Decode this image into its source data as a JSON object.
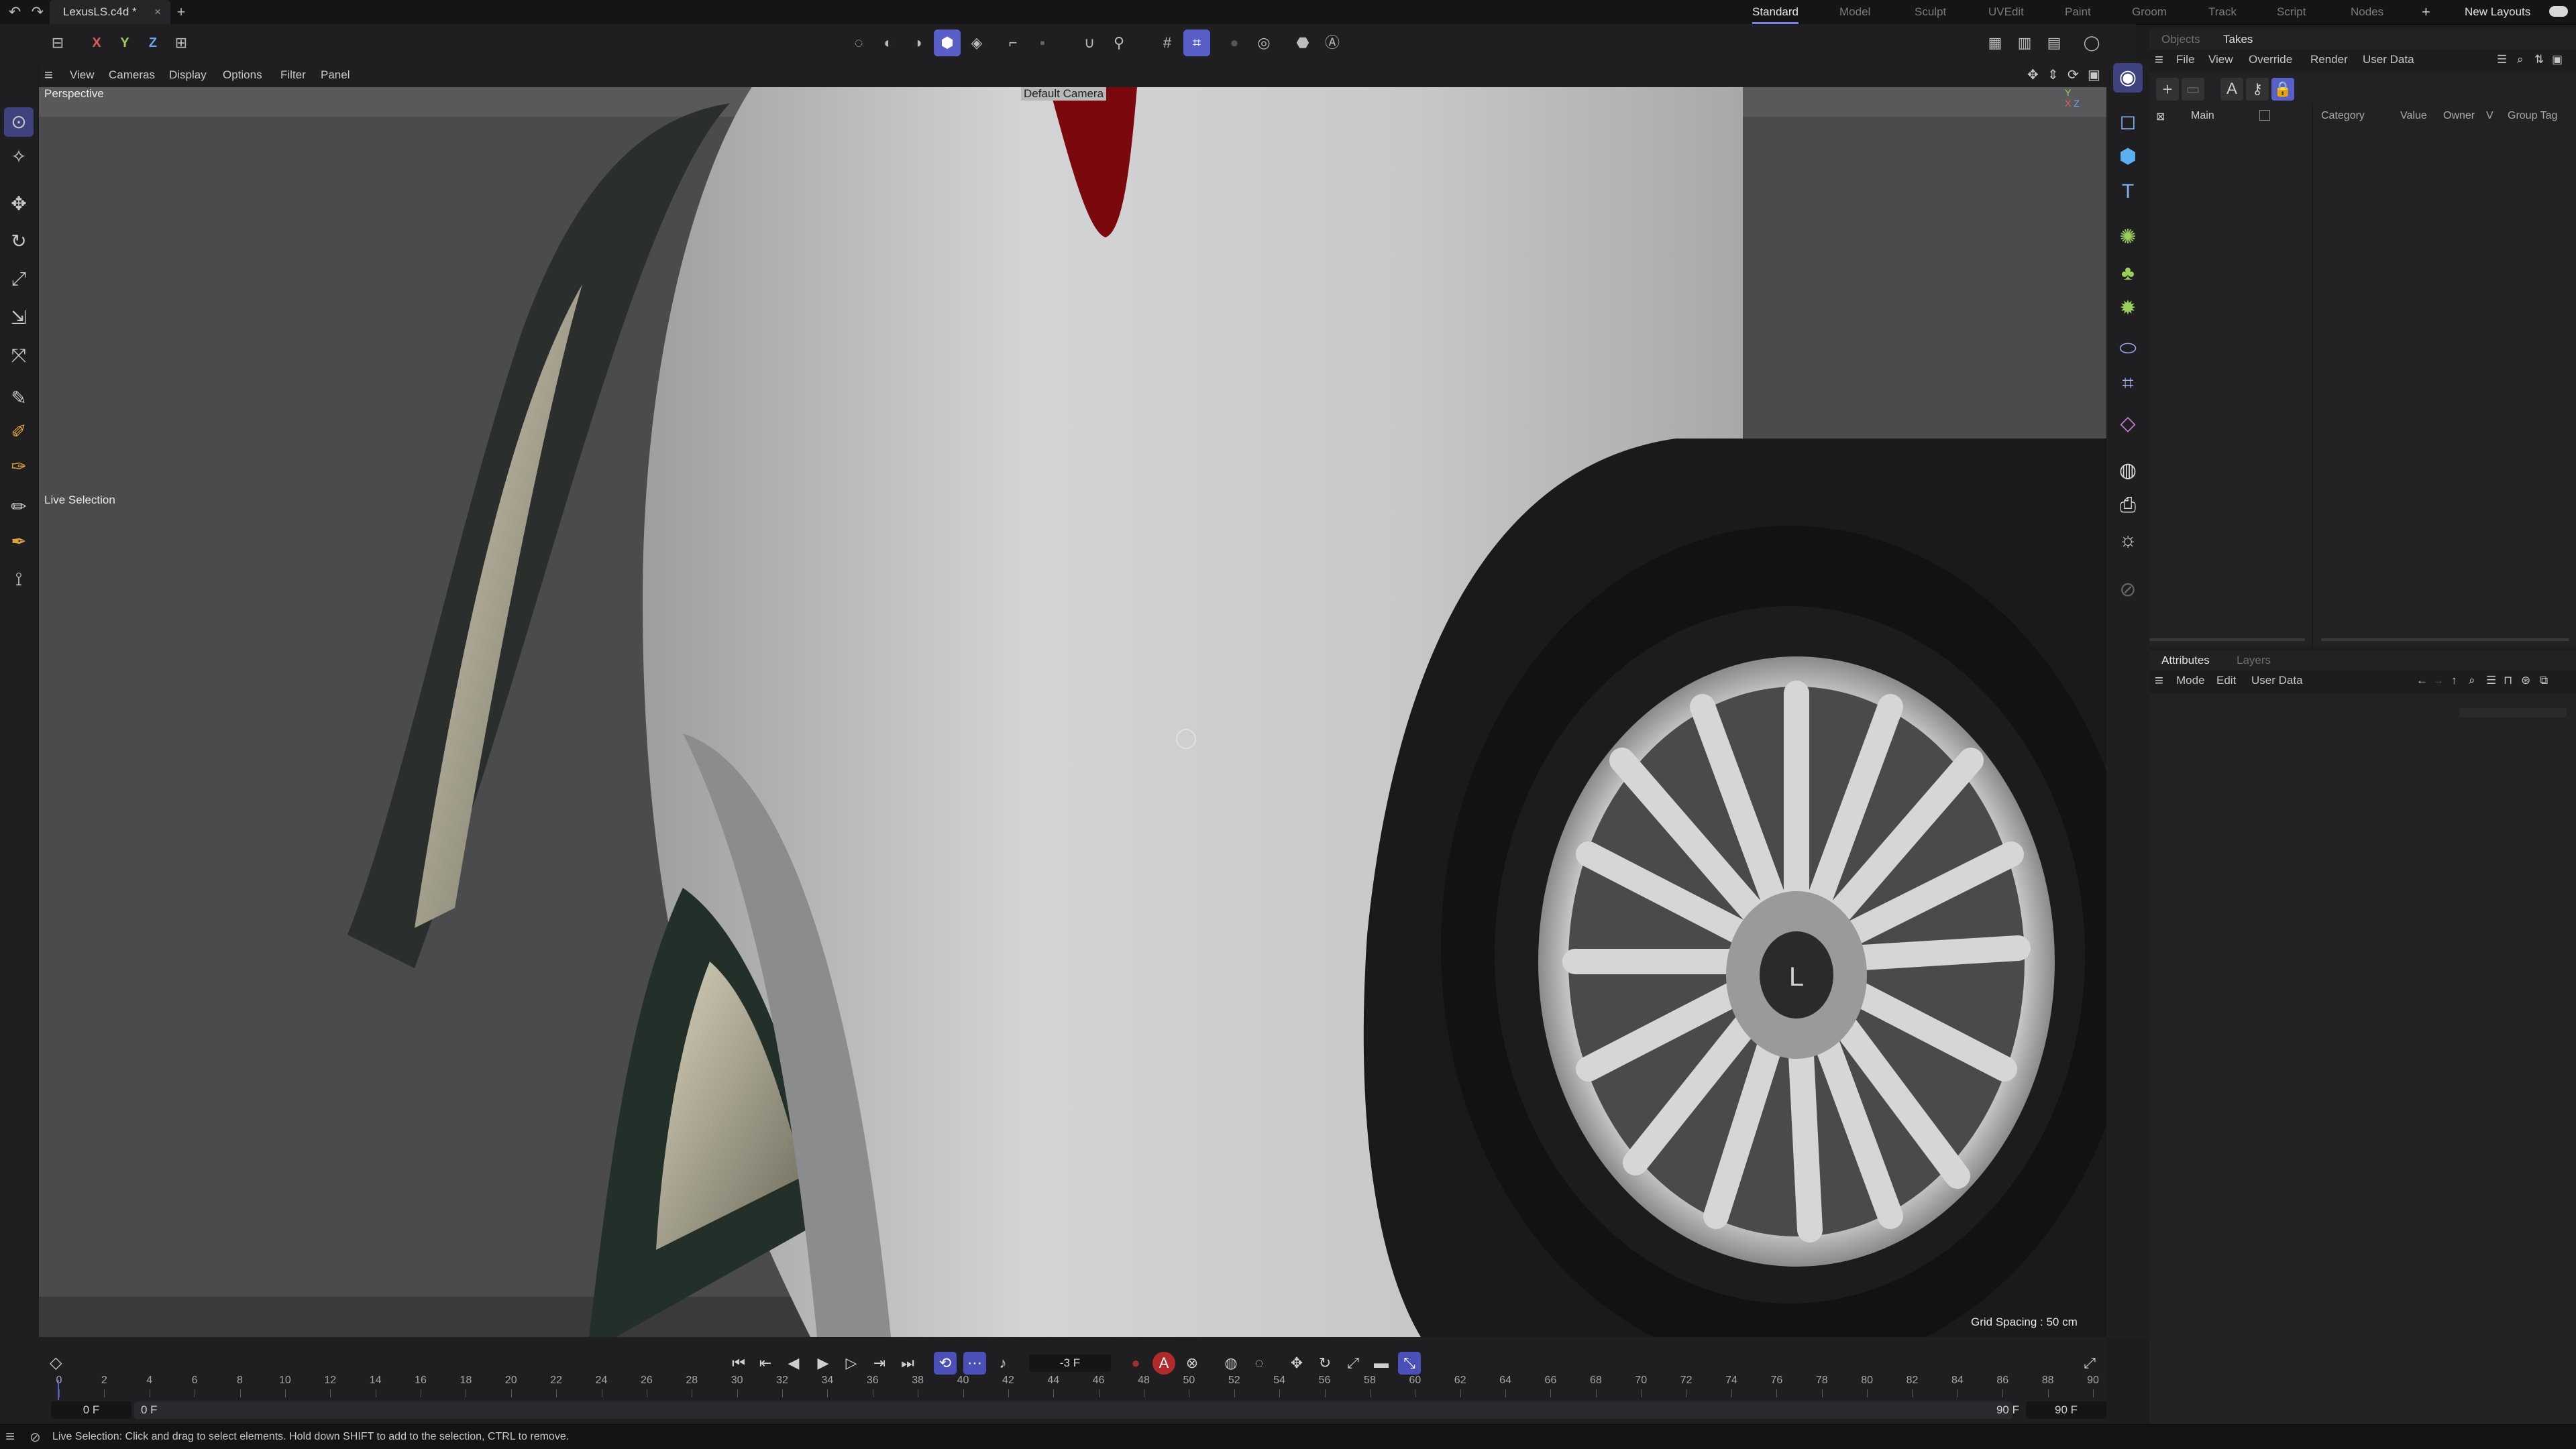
{
  "topbar": {
    "doc_tab": "LexusLS.c4d *",
    "doc_close": "×",
    "add_tab": "+",
    "layouts": [
      "Standard",
      "Model",
      "Sculpt",
      "UVEdit",
      "Paint",
      "Groom",
      "Track",
      "Script",
      "Nodes"
    ],
    "active_layout": "Standard",
    "add_layout": "+",
    "new_layouts": "New Layouts"
  },
  "coord_toggles": [
    "X",
    "Y",
    "Z"
  ],
  "viewport": {
    "menus": [
      "View",
      "Cameras",
      "Display",
      "Options",
      "Filter",
      "Panel"
    ],
    "label": "Perspective",
    "camera": "Default Camera",
    "tool_label": "Live Selection",
    "grid_spacing": "Grid Spacing : 50 cm"
  },
  "object_manager": {
    "tabs": [
      "Objects",
      "Takes"
    ],
    "active_tab": "Takes",
    "menus": [
      "File",
      "View",
      "Override",
      "Render",
      "User Data"
    ],
    "take_name": "Main",
    "columns": [
      "Category",
      "Value",
      "Owner",
      "V",
      "Group Tag"
    ]
  },
  "attribute_manager": {
    "tabs": [
      "Attributes",
      "Layers"
    ],
    "active_tab": "Attributes",
    "menus": [
      "Mode",
      "Edit",
      "User Data"
    ]
  },
  "timeline": {
    "ticks": [
      "0",
      "2",
      "4",
      "6",
      "8",
      "10",
      "12",
      "14",
      "16",
      "18",
      "20",
      "22",
      "24",
      "26",
      "28",
      "30",
      "32",
      "34",
      "36",
      "38",
      "40",
      "42",
      "44",
      "46",
      "48",
      "50",
      "52",
      "54",
      "56",
      "58",
      "60",
      "62",
      "64",
      "66",
      "68",
      "70",
      "72",
      "74",
      "76",
      "78",
      "80",
      "82",
      "84",
      "86",
      "88",
      "90"
    ],
    "current_frame": "-3 F",
    "start_frame": "0 F",
    "min_frame": "0 F",
    "max_frame": "90 F",
    "end_frame": "90 F"
  },
  "status": {
    "text": "Live Selection: Click and drag to select elements. Hold down SHIFT to add to the selection, CTRL to remove."
  },
  "colors": {
    "accent": "#5a5fc8",
    "panel_bg": "#222224",
    "viewport_bg": "#4a4a4c",
    "car_body": "#c9c9c9",
    "taillight": "#8a0a0e"
  }
}
